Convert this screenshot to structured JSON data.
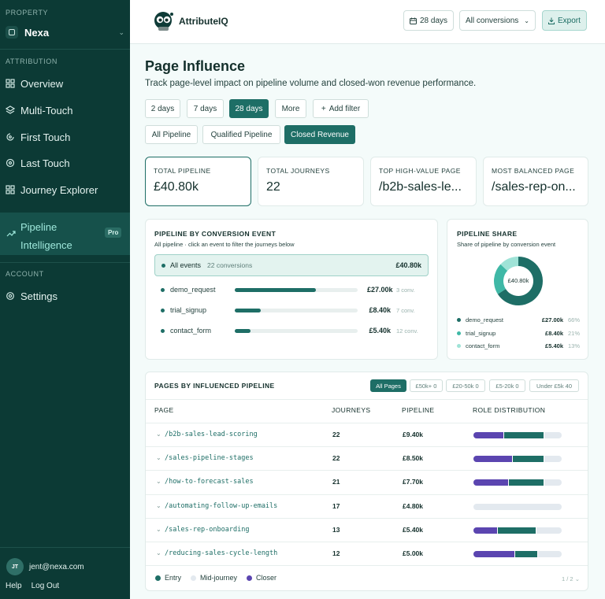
{
  "sidebar": {
    "property_label": "PROPERTY",
    "property_name": "Nexa",
    "attribution_label": "ATTRIBUTION",
    "items": [
      {
        "label": "Overview",
        "icon": "grid-icon"
      },
      {
        "label": "Multi-Touch",
        "icon": "layers-icon"
      },
      {
        "label": "First Touch",
        "icon": "first-touch-icon"
      },
      {
        "label": "Last Touch",
        "icon": "eye-icon"
      },
      {
        "label": "Journey Explorer",
        "icon": "grid-icon"
      }
    ],
    "active_item": {
      "label": "Pipeline Intelligence",
      "badge": "Pro",
      "icon": "trending-icon"
    },
    "account_label": "ACCOUNT",
    "settings_label": "Settings",
    "user_initials": "JT",
    "user_email": "jent@nexa.com",
    "help_label": "Help",
    "logout_label": "Log Out"
  },
  "topbar": {
    "brand": "AttributeIQ",
    "range_button": "28 days",
    "conversions_select": "All conversions",
    "export_label": "Export"
  },
  "page": {
    "title": "Page Influence",
    "subtitle": "Track page-level impact on pipeline volume and closed-won revenue performance."
  },
  "filters": {
    "ranges": [
      "2 days",
      "7 days",
      "28 days",
      "More"
    ],
    "active_range": "28 days",
    "add_filter": "Add filter",
    "views": [
      "All Pipeline",
      "Qualified Pipeline",
      "Closed Revenue"
    ],
    "active_view": "Closed Revenue"
  },
  "kpis": [
    {
      "label": "TOTAL PIPELINE",
      "value": "£40.80k"
    },
    {
      "label": "TOTAL JOURNEYS",
      "value": "22"
    },
    {
      "label": "TOP HIGH-VALUE PAGE",
      "value": "/b2b-sales-le..."
    },
    {
      "label": "MOST BALANCED PAGE",
      "value": "/sales-rep-on..."
    }
  ],
  "conversion_card": {
    "title": "PIPELINE BY CONVERSION EVENT",
    "subtitle": "All pipeline · click an event to filter the journeys below",
    "all_label": "All events",
    "all_count": "22 conversions",
    "all_value": "£40.80k",
    "events": [
      {
        "name": "demo_request",
        "value": "£27.00k",
        "conv": "3 conv.",
        "share": 0.66
      },
      {
        "name": "trial_signup",
        "value": "£8.40k",
        "conv": "7 conv.",
        "share": 0.21
      },
      {
        "name": "contact_form",
        "value": "£5.40k",
        "conv": "12 conv.",
        "share": 0.13
      }
    ]
  },
  "share_card": {
    "title": "PIPELINE SHARE",
    "subtitle": "Share of pipeline by conversion event",
    "center": "£40.80k",
    "legend": [
      {
        "name": "demo_request",
        "value": "£27.00k",
        "pct": "66%",
        "color": "#1e6e66"
      },
      {
        "name": "trial_signup",
        "value": "£8.40k",
        "pct": "21%",
        "color": "#3fb8a6"
      },
      {
        "name": "contact_form",
        "value": "£5.40k",
        "pct": "13%",
        "color": "#9fe3d7"
      }
    ]
  },
  "pages_table": {
    "title": "PAGES BY INFLUENCED PIPELINE",
    "segments": [
      "All Pages",
      "£50k+ 0",
      "£20-50k 0",
      "£5-20k 0",
      "Under £5k 40"
    ],
    "active_segment": "All Pages",
    "headers": [
      "PAGE",
      "JOURNEYS",
      "PIPELINE",
      "ROLE DISTRIBUTION"
    ],
    "rows": [
      {
        "page": "/b2b-sales-lead-scoring",
        "journeys": "22",
        "pipeline": "£9.40k",
        "roles": {
          "entry": 0.35,
          "mid": 0,
          "closer": 0.45
        }
      },
      {
        "page": "/sales-pipeline-stages",
        "journeys": "22",
        "pipeline": "£8.50k",
        "roles": {
          "entry": 0.45,
          "mid": 0,
          "closer": 0.35
        }
      },
      {
        "page": "/how-to-forecast-sales",
        "journeys": "21",
        "pipeline": "£7.70k",
        "roles": {
          "entry": 0.4,
          "mid": 0,
          "closer": 0.4
        }
      },
      {
        "page": "/automating-follow-up-emails",
        "journeys": "17",
        "pipeline": "£4.80k",
        "roles": {
          "entry": 0,
          "mid": 0,
          "closer": 0
        }
      },
      {
        "page": "/sales-rep-onboarding",
        "journeys": "13",
        "pipeline": "£5.40k",
        "roles": {
          "entry": 0.28,
          "mid": 0,
          "closer": 0.43
        }
      },
      {
        "page": "/reducing-sales-cycle-length",
        "journeys": "12",
        "pipeline": "£5.00k",
        "roles": {
          "entry": 0.47,
          "mid": 0,
          "closer": 0.26
        }
      }
    ],
    "legend": [
      "Entry",
      "Mid-journey",
      "Closer"
    ],
    "pager": "1 / 2"
  },
  "colors": {
    "entry": "#5b45b0",
    "mid": "#e3e9ef",
    "closer": "#1e6e66",
    "accent": "#1e6e66",
    "sidebar": "#0c3a35"
  }
}
